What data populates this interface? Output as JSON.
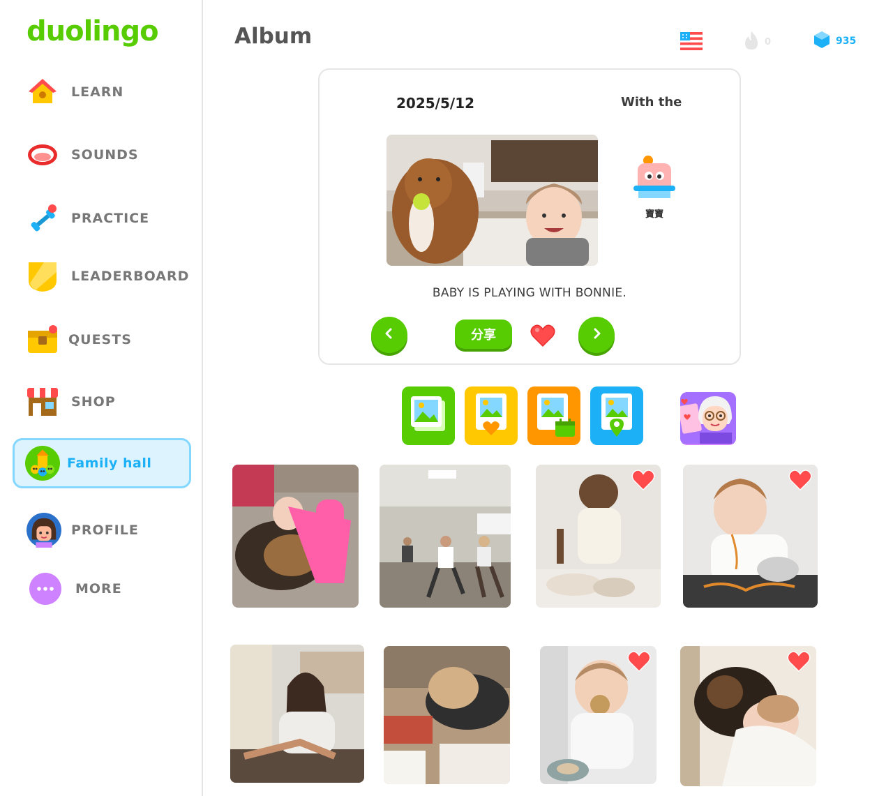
{
  "app": {
    "logo": "duolingo"
  },
  "sidebar": {
    "items": [
      {
        "label": "LEARN",
        "icon": "home-icon"
      },
      {
        "label": "SOUNDS",
        "icon": "mouth-icon"
      },
      {
        "label": "PRACTICE",
        "icon": "dumbbell-icon"
      },
      {
        "label": "LEADERBOARD",
        "icon": "shield-icon"
      },
      {
        "label": "QUESTS",
        "icon": "treasure-chest-icon"
      },
      {
        "label": "SHOP",
        "icon": "shop-icon"
      },
      {
        "label": "Family hall",
        "icon": "family-hall-icon",
        "active": true
      },
      {
        "label": "PROFILE",
        "icon": "avatar-icon"
      },
      {
        "label": "MORE",
        "icon": "more-icon"
      }
    ]
  },
  "header": {
    "title": "Album",
    "language_flag": "us-flag-icon",
    "streak": "0",
    "gems": "935"
  },
  "album_card": {
    "date": "2025/5/12",
    "with_label": "With the",
    "companion_name": "寶寶",
    "caption": "BABY IS PLAYING WITH BONNIE.",
    "share_label": "分享"
  },
  "filters": [
    {
      "name": "all-photos",
      "color": "#58cc02"
    },
    {
      "name": "favorite-photos",
      "color": "#ffc800"
    },
    {
      "name": "date-photos",
      "color": "#ff9600"
    },
    {
      "name": "location-photos",
      "color": "#1cb0f6"
    },
    {
      "name": "grandma-character",
      "color": "#ce82ff"
    }
  ],
  "photos": [
    {
      "subject": "baby-with-dog",
      "favorite": false
    },
    {
      "subject": "classroom-dance",
      "favorite": false
    },
    {
      "subject": "toddler-baking",
      "favorite": true
    },
    {
      "subject": "toddler-spaghetti",
      "favorite": true
    },
    {
      "subject": "student-classroom",
      "favorite": false
    },
    {
      "subject": "student-sleeping",
      "favorite": false
    },
    {
      "subject": "baby-eating-cookie",
      "favorite": true
    },
    {
      "subject": "toddler-sleeping-with-dog",
      "favorite": true
    }
  ],
  "colors": {
    "green": "#58cc02",
    "blue": "#1cb0f6",
    "gray_text": "#777777",
    "heart": "#ff4b4b"
  }
}
